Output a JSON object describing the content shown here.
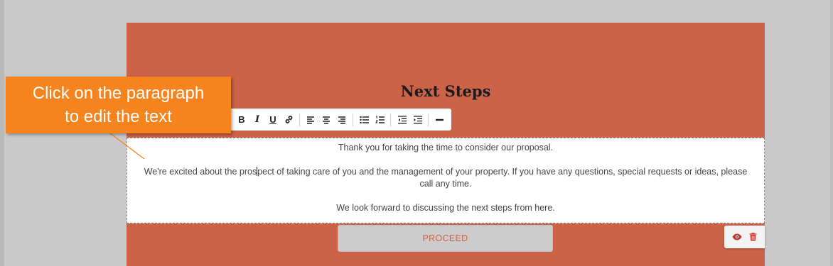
{
  "section": {
    "title": "Next Steps"
  },
  "toolbar": {
    "items": [
      "bold",
      "italic",
      "underline",
      "link",
      "align-left",
      "align-center",
      "align-right",
      "bullet-list",
      "numbered-list",
      "outdent",
      "indent",
      "horizontal-rule"
    ],
    "bold_label": "B",
    "italic_label": "I",
    "underline_label": "U"
  },
  "editor": {
    "paragraph_1": "Thank you for taking the time to consider our proposal.",
    "paragraph_2_before_caret": "We're excited about the pros",
    "paragraph_2_after_caret": "pect of taking care of you and the management of your property. If you have any questions, special requests or ideas, please call any time.",
    "paragraph_3": "We look forward to discussing the next steps from here."
  },
  "proceed_button": {
    "label": "PROCEED"
  },
  "block_actions": {
    "icons": [
      "eye-icon",
      "trash-icon"
    ]
  },
  "callout": {
    "line_1": "Click on the paragraph",
    "line_2": "to edit the text"
  },
  "colors": {
    "canvas_background": "#cc6349",
    "page_background": "#c9c9c9",
    "callout_background": "#f5841f",
    "accent": "#cc6349",
    "action_icon_color": "#c0392b"
  }
}
